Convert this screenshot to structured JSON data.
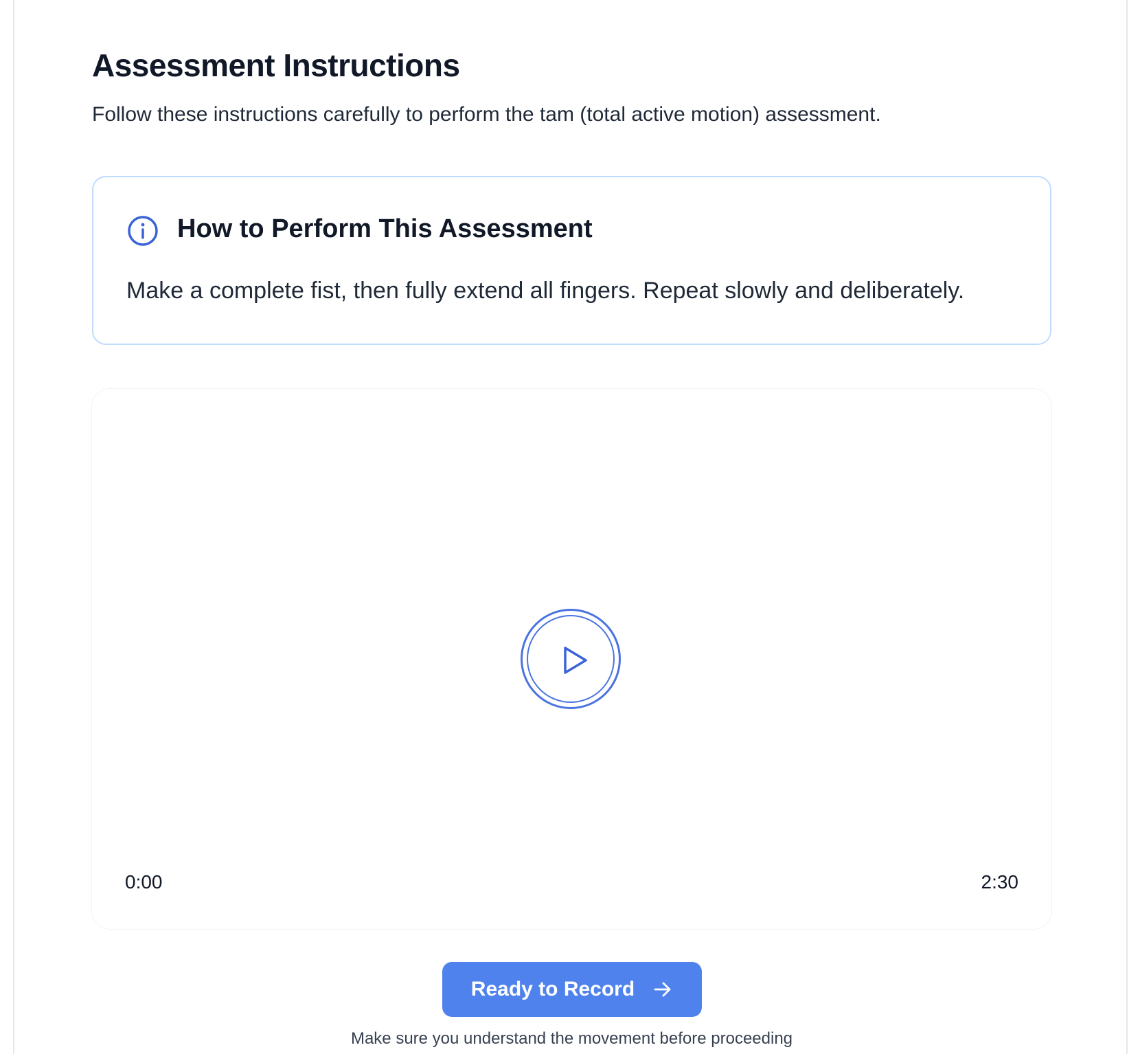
{
  "header": {
    "title": "Assessment Instructions",
    "subtitle": "Follow these instructions carefully to perform the tam (total active motion) assessment."
  },
  "info_box": {
    "icon": "info-icon",
    "title": "How to Perform This Assessment",
    "text": "Make a complete fist, then fully extend all fingers. Repeat slowly and deliberately."
  },
  "video": {
    "play_icon": "play-icon",
    "current_time": "0:00",
    "total_time": "2:30"
  },
  "actions": {
    "record_label": "Ready to Record",
    "record_icon": "arrow-right-icon",
    "hint": "Make sure you understand the movement before proceeding"
  },
  "colors": {
    "accent": "#4f82ec",
    "info_border": "#bfdbfe",
    "icon_blue": "#3b63d8"
  }
}
